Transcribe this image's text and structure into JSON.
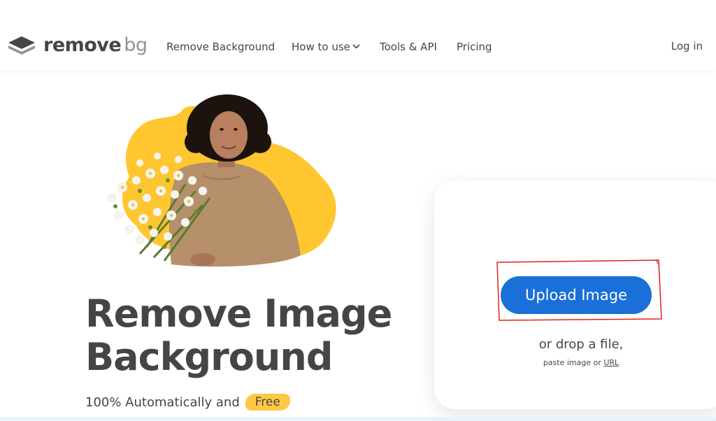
{
  "nav": {
    "logo_word1": "remove",
    "logo_word2": "bg",
    "links": [
      "Remove Background",
      "How to use",
      "Tools & API",
      "Pricing"
    ],
    "login": "Log in"
  },
  "hero": {
    "headline_line1": "Remove Image",
    "headline_line2": "Background",
    "subtitle": "100% Automatically and",
    "free_badge": "Free"
  },
  "upload": {
    "button_label": "Upload Image",
    "drop_text": "or drop a file,",
    "paste_text": "paste image or",
    "url_link": "URL"
  },
  "colors": {
    "accent": "#1a6fd9",
    "highlight": "#ffc843",
    "text": "#454545",
    "annotation": "#e0201e"
  }
}
